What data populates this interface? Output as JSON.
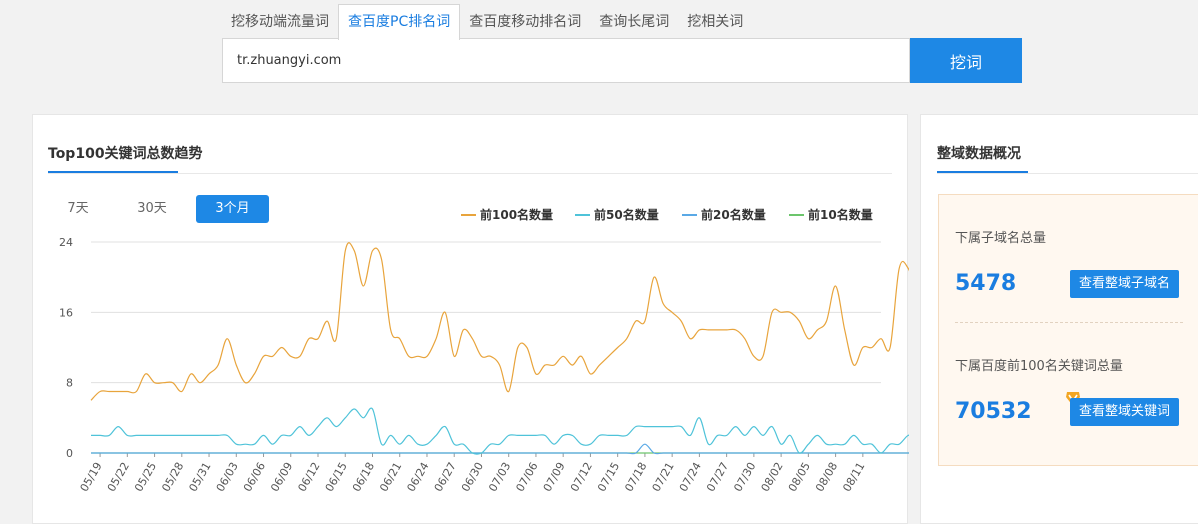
{
  "tabs": [
    {
      "label": "挖移动端流量词",
      "active": false
    },
    {
      "label": "查百度PC排名词",
      "active": true
    },
    {
      "label": "查百度移动排名词",
      "active": false
    },
    {
      "label": "查询长尾词",
      "active": false
    },
    {
      "label": "挖相关词",
      "active": false
    }
  ],
  "search": {
    "value": "tr.zhuangyi.com",
    "button_label": "挖词"
  },
  "trend_card": {
    "title": "Top100关键词总数趋势",
    "ranges": [
      {
        "label": "7天",
        "active": false
      },
      {
        "label": "30天",
        "active": false
      },
      {
        "label": "3个月",
        "active": true
      }
    ]
  },
  "chart_data": {
    "type": "line",
    "y_ticks": [
      0,
      8,
      16,
      24
    ],
    "ylim": [
      0,
      24
    ],
    "grid": true,
    "legend_position": "top-right",
    "x_tick_labels": [
      "05/19",
      "05/22",
      "05/25",
      "05/28",
      "05/31",
      "06/03",
      "06/06",
      "06/09",
      "06/12",
      "06/15",
      "06/18",
      "06/21",
      "06/24",
      "06/27",
      "06/30",
      "07/03",
      "07/06",
      "07/09",
      "07/12",
      "07/15",
      "07/18",
      "07/21",
      "07/24",
      "07/27",
      "07/30",
      "08/02",
      "08/05",
      "08/08",
      "08/11"
    ],
    "x": [
      "05/18",
      "05/19",
      "05/20",
      "05/21",
      "05/22",
      "05/23",
      "05/24",
      "05/25",
      "05/26",
      "05/27",
      "05/28",
      "05/29",
      "05/30",
      "05/31",
      "06/01",
      "06/02",
      "06/03",
      "06/04",
      "06/05",
      "06/06",
      "06/07",
      "06/08",
      "06/09",
      "06/10",
      "06/11",
      "06/12",
      "06/13",
      "06/14",
      "06/15",
      "06/16",
      "06/17",
      "06/18",
      "06/19",
      "06/20",
      "06/21",
      "06/22",
      "06/23",
      "06/24",
      "06/25",
      "06/26",
      "06/27",
      "06/28",
      "06/29",
      "06/30",
      "07/01",
      "07/02",
      "07/03",
      "07/04",
      "07/05",
      "07/06",
      "07/07",
      "07/08",
      "07/09",
      "07/10",
      "07/11",
      "07/12",
      "07/13",
      "07/14",
      "07/15",
      "07/16",
      "07/17",
      "07/18",
      "07/19",
      "07/20",
      "07/21",
      "07/22",
      "07/23",
      "07/24",
      "07/25",
      "07/26",
      "07/27",
      "07/28",
      "07/29",
      "07/30",
      "07/31",
      "08/01",
      "08/02",
      "08/03",
      "08/04",
      "08/05",
      "08/06",
      "08/07",
      "08/08",
      "08/09",
      "08/10",
      "08/11",
      "08/12",
      "08/13"
    ],
    "series": [
      {
        "name": "前100名数量",
        "color": "#e8a43c",
        "values": [
          6,
          7,
          7,
          7,
          7,
          7,
          9,
          8,
          8,
          8,
          7,
          9,
          8,
          9,
          10,
          13,
          10,
          8,
          9,
          11,
          11,
          12,
          11,
          11,
          13,
          13,
          15,
          13,
          23,
          23,
          19,
          23,
          22,
          14,
          13,
          11,
          11,
          11,
          13,
          16,
          11,
          14,
          13,
          11,
          11,
          10,
          7,
          12,
          12,
          9,
          10,
          10,
          11,
          10,
          11,
          9,
          10,
          11,
          12,
          13,
          15,
          15,
          20,
          17,
          16,
          15,
          13,
          14,
          14,
          14,
          14,
          14,
          13,
          11,
          11,
          16,
          16,
          16,
          15,
          13,
          14,
          15,
          19,
          14,
          10,
          12,
          12,
          13,
          12,
          21,
          21,
          18,
          17,
          20
        ]
      },
      {
        "name": "前50名数量",
        "color": "#4fc3d9",
        "values": [
          2,
          2,
          2,
          3,
          2,
          2,
          2,
          2,
          2,
          2,
          2,
          2,
          2,
          2,
          2,
          2,
          1,
          1,
          1,
          2,
          1,
          2,
          2,
          3,
          2,
          3,
          4,
          3,
          4,
          5,
          4,
          5,
          1,
          2,
          1,
          2,
          1,
          1,
          2,
          3,
          1,
          1,
          0,
          0,
          1,
          1,
          2,
          2,
          2,
          2,
          2,
          1,
          2,
          2,
          1,
          1,
          2,
          2,
          2,
          2,
          3,
          3,
          3,
          3,
          3,
          3,
          2,
          4,
          1,
          2,
          2,
          3,
          2,
          3,
          2,
          3,
          1,
          2,
          0,
          1,
          2,
          1,
          1,
          1,
          2,
          1,
          1,
          0,
          1,
          1,
          2,
          2,
          2,
          3
        ]
      },
      {
        "name": "前20名数量",
        "color": "#5aa9e6",
        "values": [
          0,
          0,
          0,
          0,
          0,
          0,
          0,
          0,
          0,
          0,
          0,
          0,
          0,
          0,
          0,
          0,
          0,
          0,
          0,
          0,
          0,
          0,
          0,
          0,
          0,
          0,
          0,
          0,
          0,
          0,
          0,
          0,
          0,
          0,
          0,
          0,
          0,
          0,
          0,
          0,
          0,
          0,
          0,
          0,
          0,
          0,
          0,
          0,
          0,
          0,
          0,
          0,
          0,
          0,
          0,
          0,
          0,
          0,
          0,
          0,
          0,
          1,
          0,
          0,
          0,
          0,
          0,
          0,
          0,
          0,
          0,
          0,
          0,
          0,
          0,
          0,
          0,
          0,
          0,
          0,
          0,
          0,
          0,
          0,
          0,
          0,
          0,
          0,
          0,
          0,
          0,
          0,
          0,
          0
        ]
      },
      {
        "name": "前10名数量",
        "color": "#6cc56c",
        "values": [
          0,
          0,
          0,
          0,
          0,
          0,
          0,
          0,
          0,
          0,
          0,
          0,
          0,
          0,
          0,
          0,
          0,
          0,
          0,
          0,
          0,
          0,
          0,
          0,
          0,
          0,
          0,
          0,
          0,
          0,
          0,
          0,
          0,
          0,
          0,
          0,
          0,
          0,
          0,
          0,
          0,
          0,
          0,
          0,
          0,
          0,
          0,
          0,
          0,
          0,
          0,
          0,
          0,
          0,
          0,
          0,
          0,
          0,
          0,
          0,
          0,
          0,
          0,
          0,
          0,
          0,
          0,
          0,
          0,
          0,
          0,
          0,
          0,
          0,
          0,
          0,
          0,
          0,
          0,
          0,
          0,
          0,
          0,
          0,
          0,
          0,
          0,
          0,
          0,
          0,
          0,
          0,
          0,
          0
        ]
      }
    ]
  },
  "domain_card": {
    "title": "整域数据概况",
    "stats": [
      {
        "label": "下属子域名总量",
        "value": "5478",
        "button": "查看整域子域名"
      },
      {
        "label": "下属百度前100名关键词总量",
        "value": "70532",
        "button": "查看整域关键词"
      }
    ],
    "medal_icon": "medal-icon"
  }
}
